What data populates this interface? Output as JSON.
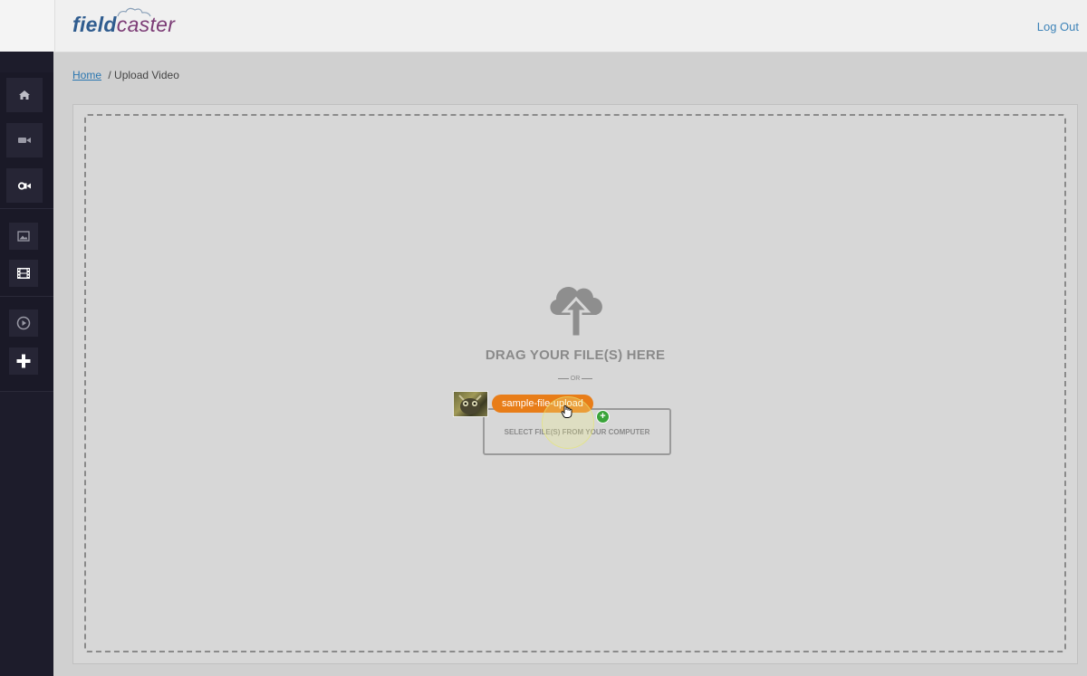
{
  "header": {
    "logo_part1": "field",
    "logo_part2": "caster",
    "logout_label": "Log Out"
  },
  "sidebar": {
    "items": [
      {
        "name": "home",
        "icon": "home-icon"
      },
      {
        "name": "videos",
        "icon": "video-camera-icon"
      },
      {
        "name": "live",
        "icon": "live-camera-icon"
      },
      {
        "name": "images",
        "icon": "image-icon"
      },
      {
        "name": "films",
        "icon": "film-icon"
      },
      {
        "name": "play",
        "icon": "play-circle-icon"
      },
      {
        "name": "add",
        "icon": "plus-icon"
      }
    ]
  },
  "breadcrumb": {
    "home_label": "Home",
    "separator_current": "/ Upload Video"
  },
  "upload": {
    "drag_text": "DRAG YOUR FILE(S) HERE",
    "or_text": "OR",
    "select_button_label": "SELECT FILE(S) FROM YOUR COMPUTER"
  },
  "drag_ghost": {
    "file_name": "sample-file-upload",
    "badge": "+"
  },
  "colors": {
    "brand_blue": "#2f5c8f",
    "brand_purple": "#7b3b75",
    "sidebar_bg": "#1d1c2b",
    "drag_label": "#e87d18",
    "copy_badge": "#3aa43a"
  }
}
